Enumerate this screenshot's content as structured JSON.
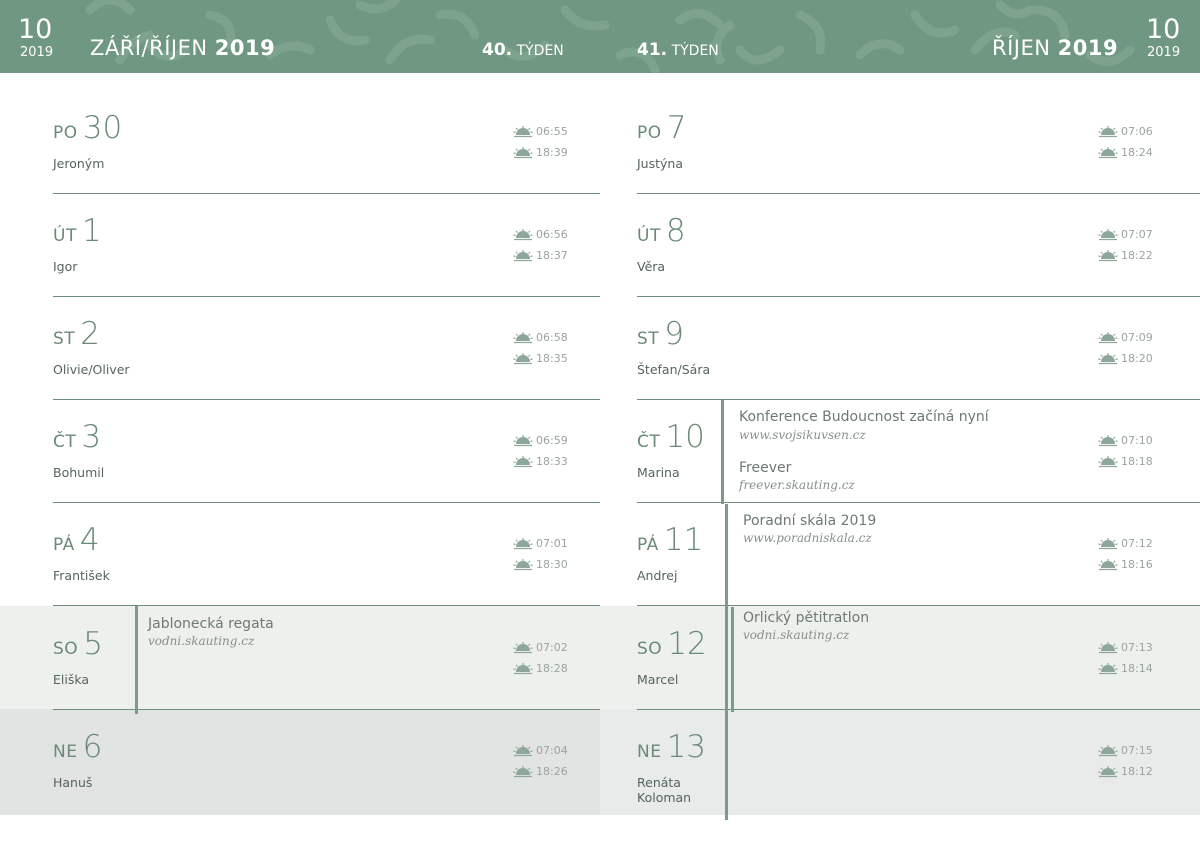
{
  "header": {
    "left": {
      "num": "10",
      "year": "2019",
      "month_light": "ZÁŘÍ/ŘÍJEN",
      "month_bold": "2019",
      "week_num": "40.",
      "week_label": "TÝDEN"
    },
    "right": {
      "num": "10",
      "year": "2019",
      "month_light": "ŘÍJEN",
      "month_bold": "2019",
      "week_num": "41.",
      "week_label": "TÝDEN"
    }
  },
  "left_days": [
    {
      "abbr": "PO",
      "num": "30",
      "names": [
        "Jeroným"
      ],
      "sunrise": "06:55",
      "sunset": "18:39"
    },
    {
      "abbr": "ÚT",
      "num": "1",
      "names": [
        "Igor"
      ],
      "sunrise": "06:56",
      "sunset": "18:37"
    },
    {
      "abbr": "ST",
      "num": "2",
      "names": [
        "Olivie/Oliver"
      ],
      "sunrise": "06:58",
      "sunset": "18:35"
    },
    {
      "abbr": "ČT",
      "num": "3",
      "names": [
        "Bohumil"
      ],
      "sunrise": "06:59",
      "sunset": "18:33"
    },
    {
      "abbr": "PÁ",
      "num": "4",
      "names": [
        "František"
      ],
      "sunrise": "07:01",
      "sunset": "18:30"
    },
    {
      "abbr": "SO",
      "num": "5",
      "names": [
        "Eliška"
      ],
      "sunrise": "07:02",
      "sunset": "18:28"
    },
    {
      "abbr": "NE",
      "num": "6",
      "names": [
        "Hanuš"
      ],
      "sunrise": "07:04",
      "sunset": "18:26"
    }
  ],
  "right_days": [
    {
      "abbr": "PO",
      "num": "7",
      "names": [
        "Justýna"
      ],
      "sunrise": "07:06",
      "sunset": "18:24"
    },
    {
      "abbr": "ÚT",
      "num": "8",
      "names": [
        "Věra"
      ],
      "sunrise": "07:07",
      "sunset": "18:22"
    },
    {
      "abbr": "ST",
      "num": "9",
      "names": [
        "Štefan/Sára"
      ],
      "sunrise": "07:09",
      "sunset": "18:20"
    },
    {
      "abbr": "ČT",
      "num": "10",
      "names": [
        "Marina"
      ],
      "sunrise": "07:10",
      "sunset": "18:18"
    },
    {
      "abbr": "PÁ",
      "num": "11",
      "names": [
        "Andrej"
      ],
      "sunrise": "07:12",
      "sunset": "18:16"
    },
    {
      "abbr": "SO",
      "num": "12",
      "names": [
        "Marcel"
      ],
      "sunrise": "07:13",
      "sunset": "18:14"
    },
    {
      "abbr": "NE",
      "num": "13",
      "names": [
        "Renáta",
        "Koloman"
      ],
      "sunrise": "07:15",
      "sunset": "18:12"
    }
  ],
  "events": {
    "jablonecka": {
      "title": "Jablonecká regata",
      "url": "vodni.skauting.cz"
    },
    "konference": {
      "title": "Konference Budoucnost začíná nyní",
      "url": "www.svojsikuvsen.cz"
    },
    "freever": {
      "title": "Freever",
      "url": "freever.skauting.cz"
    },
    "poradni": {
      "title": "Poradní skála 2019",
      "url": "www.poradniskala.cz"
    },
    "orlicky": {
      "title": "Orlický pětitratlon",
      "url": "vodni.skauting.cz"
    }
  }
}
